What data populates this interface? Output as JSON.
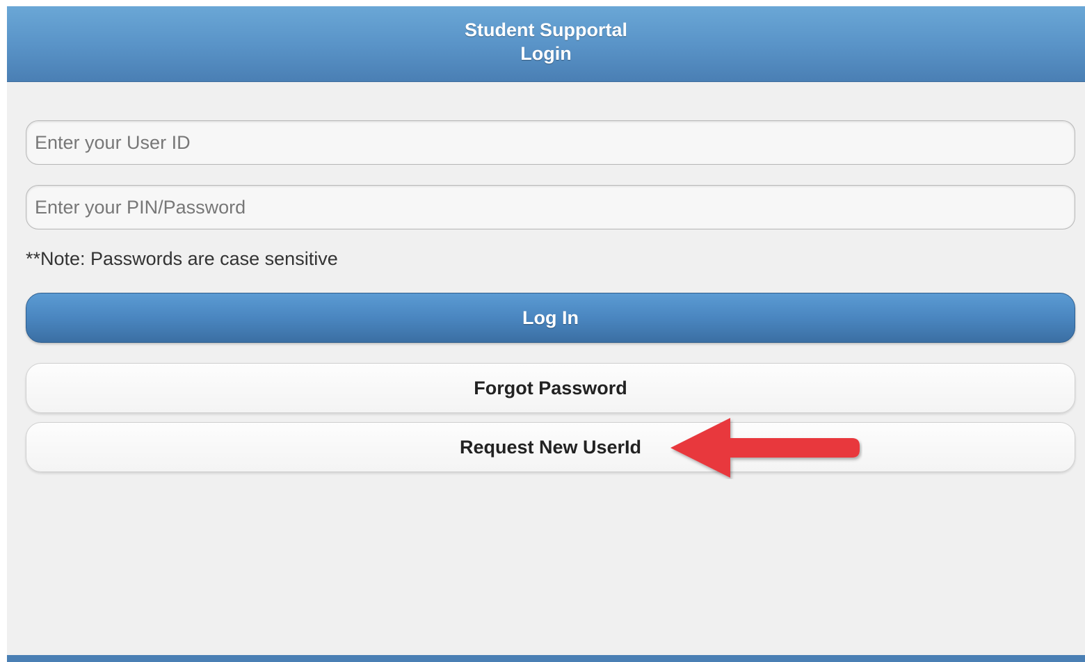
{
  "header": {
    "title_line1": "Student Supportal",
    "title_line2": "Login"
  },
  "form": {
    "user_id": {
      "placeholder": "Enter your User ID",
      "value": ""
    },
    "password": {
      "placeholder": "Enter your PIN/Password",
      "value": ""
    },
    "note": "**Note: Passwords are case sensitive"
  },
  "buttons": {
    "login": "Log In",
    "forgot_password": "Forgot Password",
    "request_new_userid": "Request New UserId"
  },
  "annotation": {
    "icon": "red-arrow-icon",
    "color": "#e8373c"
  },
  "colors": {
    "header": "#5a94c8",
    "primary_button": "#4a86c0",
    "background": "#f0f0f0"
  }
}
